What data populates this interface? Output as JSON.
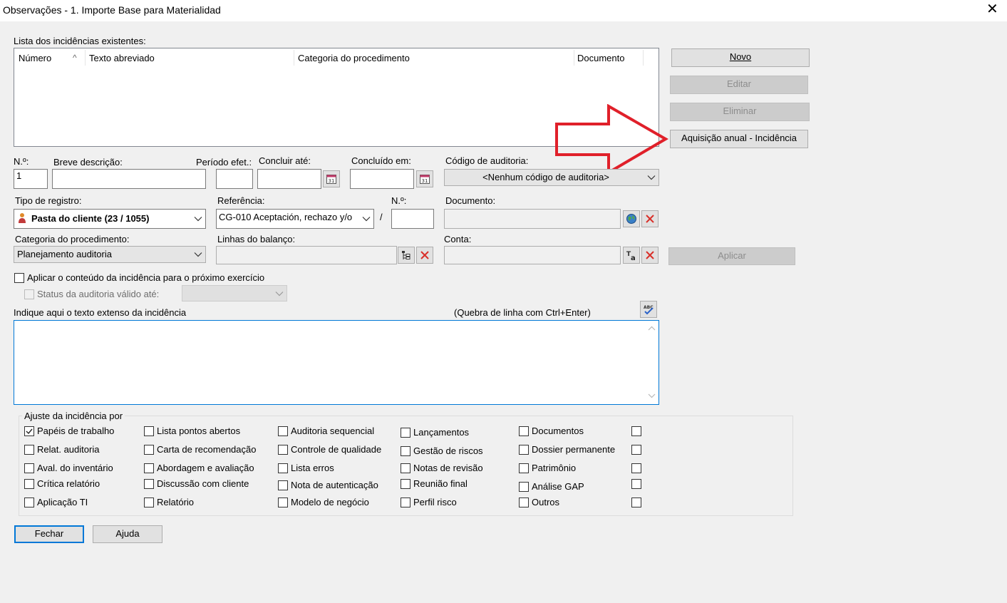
{
  "window": {
    "title": "Observações - 1. Importe Base para Materialidad",
    "close_glyph": "✕"
  },
  "list": {
    "label": "Lista dos incidências existentes:",
    "columns": [
      "Número",
      "Texto abreviado",
      "Categoria do procedimento",
      "Documento"
    ],
    "sort_glyph": "^"
  },
  "side_buttons": {
    "novo": "Novo",
    "editar": "Editar",
    "eliminar": "Eliminar",
    "aquisicao": "Aquisição anual - Incidência"
  },
  "row1": {
    "num_label": "N.º:",
    "num_value": "1",
    "breve_label": "Breve descrição:",
    "breve_value": "",
    "periodo_label": "Período efet.:",
    "periodo_value": "",
    "concluir_label": "Concluir até:",
    "concluir_value": "",
    "concluido_label": "Concluído em:",
    "concluido_value": "",
    "codigo_label": "Código de auditoria:",
    "codigo_value": "<Nenhum código de auditoria>"
  },
  "row2": {
    "tipo_label": "Tipo de registro:",
    "tipo_value": "Pasta do cliente (23 / 1055)",
    "referencia_label": "Referência:",
    "referencia_value": "CG-010  Aceptación, rechazo y/o",
    "slash": "/",
    "num_label": "N.º:",
    "num_value": "",
    "documento_label": "Documento:",
    "documento_value": ""
  },
  "row3": {
    "categoria_label": "Categoria do procedimento:",
    "categoria_value": "Planejamento auditoria",
    "linhas_label": "Linhas do balanço:",
    "linhas_value": "",
    "conta_label": "Conta:",
    "conta_value": "",
    "aplicar_label": "Aplicar"
  },
  "options": {
    "aplicar_conteudo": "Aplicar o conteúdo da incidência para o próximo exercício",
    "status_valido": "Status da auditoria válido até:"
  },
  "text_area": {
    "label": "Indique aqui o texto extenso da incidência",
    "hint": "(Quebra de linha com Ctrl+Enter)",
    "value": ""
  },
  "ajuste": {
    "title": "Ajuste da incidência por",
    "columns": [
      [
        {
          "label": "Papéis de trabalho",
          "checked": true
        },
        {
          "label": "Relat. auditoria",
          "checked": false
        },
        {
          "label": "Aval. do inventário",
          "checked": false
        },
        {
          "label": "Crítica relatório",
          "checked": false
        },
        {
          "label": "Aplicação TI",
          "checked": false
        }
      ],
      [
        {
          "label": "Lista pontos abertos",
          "checked": false
        },
        {
          "label": "Carta de recomendação",
          "checked": false
        },
        {
          "label": "Abordagem e avaliação",
          "checked": false
        },
        {
          "label": "Discussão com cliente",
          "checked": false
        },
        {
          "label": "Relatório",
          "checked": false
        }
      ],
      [
        {
          "label": "Auditoria sequencial",
          "checked": false
        },
        {
          "label": "Controle de qualidade",
          "checked": false
        },
        {
          "label": "Lista erros",
          "checked": false
        },
        {
          "label": "Nota de autenticação",
          "checked": false
        },
        {
          "label": "Modelo de negócio",
          "checked": false
        }
      ],
      [
        {
          "label": "Lançamentos",
          "checked": false
        },
        {
          "label": "Gestão de riscos",
          "checked": false
        },
        {
          "label": "Notas de revisão",
          "checked": false
        },
        {
          "label": "Reunião final",
          "checked": false
        },
        {
          "label": "Perfil risco",
          "checked": false
        }
      ],
      [
        {
          "label": "Documentos",
          "checked": false
        },
        {
          "label": "Dossier permanente",
          "checked": false
        },
        {
          "label": "Patrimônio",
          "checked": false
        },
        {
          "label": "Análise GAP",
          "checked": false
        },
        {
          "label": "Outros",
          "checked": false
        }
      ],
      [
        {
          "label": "",
          "checked": false
        },
        {
          "label": "",
          "checked": false
        },
        {
          "label": "",
          "checked": false
        },
        {
          "label": "",
          "checked": false
        },
        {
          "label": "",
          "checked": false
        }
      ]
    ]
  },
  "bottom_buttons": {
    "fechar": "Fechar",
    "ajuda": "Ajuda"
  },
  "colors": {
    "annotation_arrow": "#e0202a",
    "focus_blue": "#0078d7",
    "delete_red": "#d9302a"
  },
  "icons": [
    "calendar-icon",
    "globe-icon",
    "delete-icon",
    "tree-icon",
    "text-format-icon",
    "spellcheck-icon",
    "person-icon",
    "chevron-down-icon",
    "check-icon",
    "arrow-icon"
  ]
}
